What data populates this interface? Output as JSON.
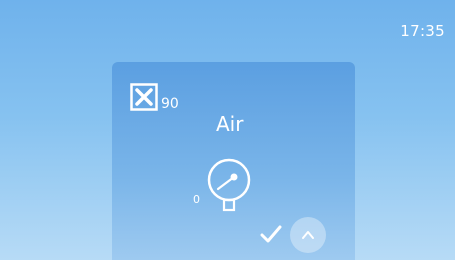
{
  "status_bar": {
    "time": "17:35"
  },
  "card": {
    "limit_icon": "close-box-icon",
    "limit_value": "90",
    "mode_label": "Air",
    "gauge_icon": "pressure-gauge-icon",
    "gauge_min": "0",
    "confirm_icon": "checkmark-icon",
    "scroll_icon": "chevron-up-icon"
  },
  "colors": {
    "background_top": "#6fb2ec",
    "card_top": "#5b9fe1",
    "foreground": "#ffffff"
  }
}
